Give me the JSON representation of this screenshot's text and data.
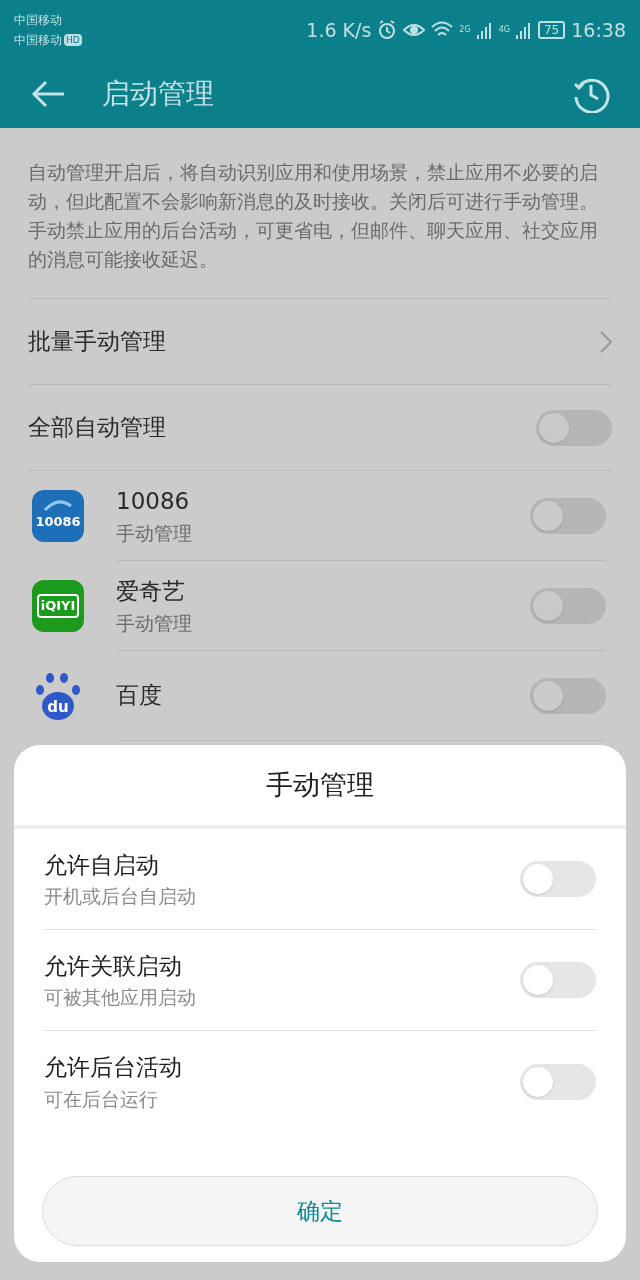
{
  "status_bar": {
    "carriers": [
      "中国移动",
      "中国移动"
    ],
    "hd_badge": "HD",
    "speed": "1.6 K/s",
    "network_labels": [
      "2G",
      "4G"
    ],
    "battery": "75",
    "time": "16:38"
  },
  "app_bar": {
    "title": "启动管理"
  },
  "description": [
    "自动管理开启后，将自动识别应用和使用场景，禁止应用不必要的启动，但此配置不会影响新消息的及时接收。关闭后可进行手动管理。",
    "手动禁止应用的后台活动，可更省电，但邮件、聊天应用、社交应用的消息可能接收延迟。"
  ],
  "batch_row": {
    "label": "批量手动管理"
  },
  "all_auto": {
    "label": "全部自动管理",
    "on": false
  },
  "apps": [
    {
      "name": "10086",
      "subtitle": "手动管理",
      "icon_text": "10086",
      "kind": "mobile",
      "on": false
    },
    {
      "name": "爱奇艺",
      "subtitle": "手动管理",
      "icon_text": "iQIYI",
      "kind": "video",
      "on": false
    },
    {
      "name": "百度",
      "icon_text": "du",
      "kind": "paw",
      "on": false
    }
  ],
  "sheet": {
    "title": "手动管理",
    "options": [
      {
        "label": "允许自启动",
        "hint": "开机或后台自启动",
        "on": false
      },
      {
        "label": "允许关联启动",
        "hint": "可被其他应用启动",
        "on": false
      },
      {
        "label": "允许后台活动",
        "hint": "可在后台运行",
        "on": false
      }
    ],
    "confirm": "确定"
  }
}
